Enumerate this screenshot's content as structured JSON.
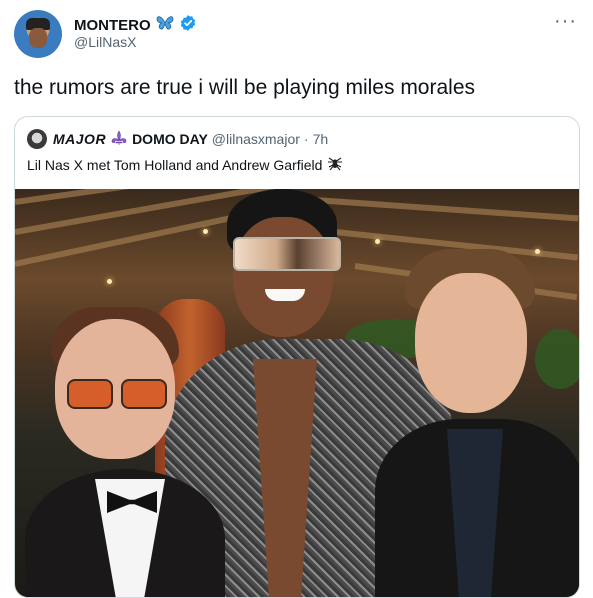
{
  "tweet": {
    "author_name": "MONTERO",
    "author_handle": "@LilNasX",
    "verified": true,
    "name_emoji": "butterfly-icon",
    "text": "the rumors are true i will be playing miles morales",
    "menu_label": "···"
  },
  "quoted_tweet": {
    "author_name_part1": "MAJOR",
    "author_name_part2": "DOMO DAY",
    "name_emoji": "fleur-de-lis-icon",
    "author_handle": "@lilnasxmajor",
    "separator": "·",
    "time": "7h",
    "text": "Lil Nas X met Tom Holland and Andrew Garfield",
    "text_emoji": "spider-icon"
  },
  "colors": {
    "verified_blue": "#1d9bf0",
    "secondary_text": "#536471",
    "border": "#cfd9de"
  }
}
